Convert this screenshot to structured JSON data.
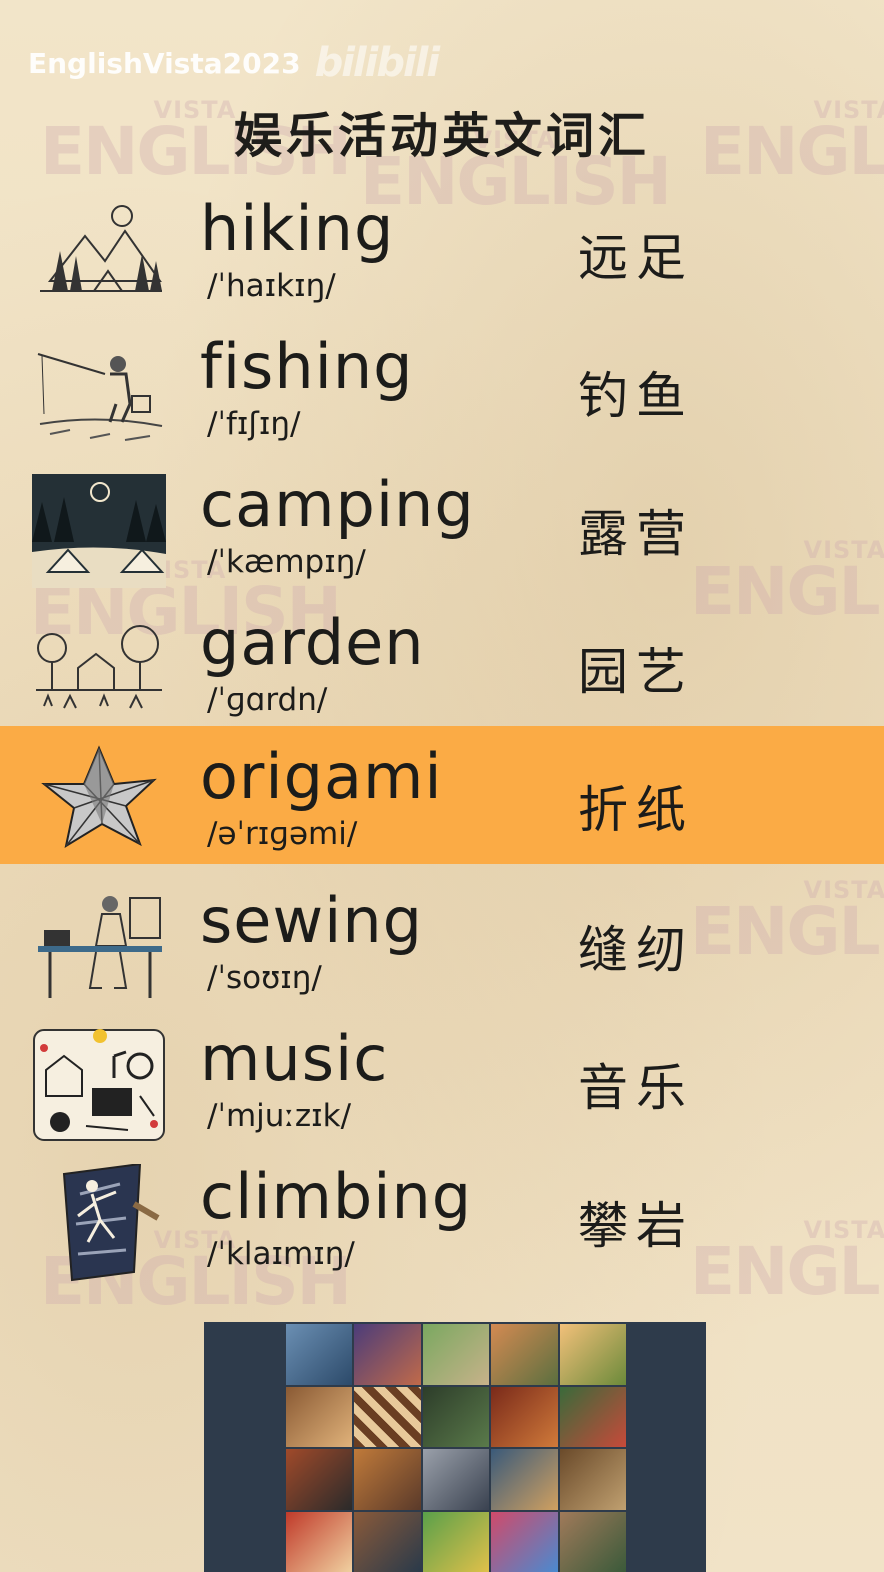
{
  "header": {
    "channel": "EnglishVista2023",
    "platform": "bilibili",
    "watermark_top": "VISTA",
    "watermark_bottom": "ENGLISH"
  },
  "title": "娱乐活动英文词汇",
  "vocab": [
    {
      "word": "hiking",
      "ipa": "/ˈhaɪkɪŋ/",
      "cn": "远足",
      "icon": "hiking-sketch-icon"
    },
    {
      "word": "fishing",
      "ipa": "/ˈfɪʃɪŋ/",
      "cn": "钓鱼",
      "icon": "fishing-sketch-icon"
    },
    {
      "word": "camping",
      "ipa": "/ˈkæmpɪŋ/",
      "cn": "露营",
      "icon": "camping-sketch-icon"
    },
    {
      "word": "garden",
      "ipa": "/ˈɡɑrdn/",
      "cn": "园艺",
      "icon": "garden-sketch-icon"
    },
    {
      "word": "origami",
      "ipa": "/əˈrɪɡəmi/",
      "cn": "折纸",
      "icon": "origami-star-icon",
      "highlighted": true
    },
    {
      "word": "sewing",
      "ipa": "/ˈsoʊɪŋ/",
      "cn": "缝纫",
      "icon": "sewing-sketch-icon"
    },
    {
      "word": "music",
      "ipa": "/ˈmjuːzɪk/",
      "cn": "音乐",
      "icon": "music-doodle-icon"
    },
    {
      "word": "climbing",
      "ipa": "/ˈklaɪmɪŋ/",
      "cn": "攀岩",
      "icon": "climbing-sketch-icon"
    }
  ],
  "colors": {
    "background": "#f2e5c9",
    "highlight": "#fbab45",
    "text": "#1c1c1a",
    "collage_bg": "#2e3b4b"
  }
}
